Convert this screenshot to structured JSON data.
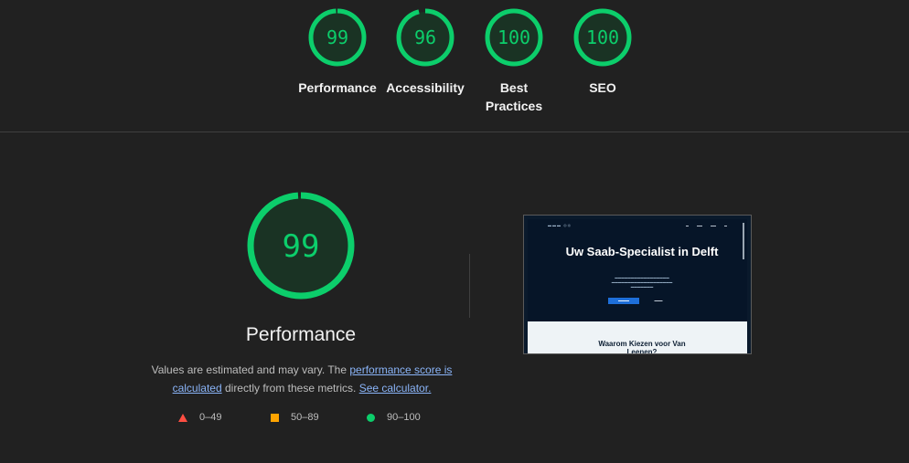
{
  "top_scores": [
    {
      "score": "99",
      "label": "Performance",
      "fraction": 0.99
    },
    {
      "score": "96",
      "label": "Accessibility",
      "fraction": 0.96
    },
    {
      "score": "100",
      "label": "Best Practices",
      "fraction": 1.0
    },
    {
      "score": "100",
      "label": "SEO",
      "fraction": 1.0
    }
  ],
  "main": {
    "score": "99",
    "fraction": 0.99,
    "title": "Performance",
    "desc_prefix": "Values are estimated and may vary. The ",
    "desc_link1": "performance score is calculated",
    "desc_middle": " directly from these metrics. ",
    "desc_link2": "See calculator."
  },
  "legend": [
    {
      "range": "0–49",
      "shape": "triangle",
      "color": "#ff4e42"
    },
    {
      "range": "50–89",
      "shape": "square",
      "color": "#ffa400"
    },
    {
      "range": "90–100",
      "shape": "circle",
      "color": "#0cce6b"
    }
  ],
  "colors": {
    "pass": "#0cce6b",
    "pass_bg": "#1a3324",
    "track": "#0cce6b"
  },
  "thumbnail": {
    "hero_title": "Uw Saab-Specialist in Delft",
    "section_title": "Waarom Kiezen voor Van Leenen?"
  }
}
